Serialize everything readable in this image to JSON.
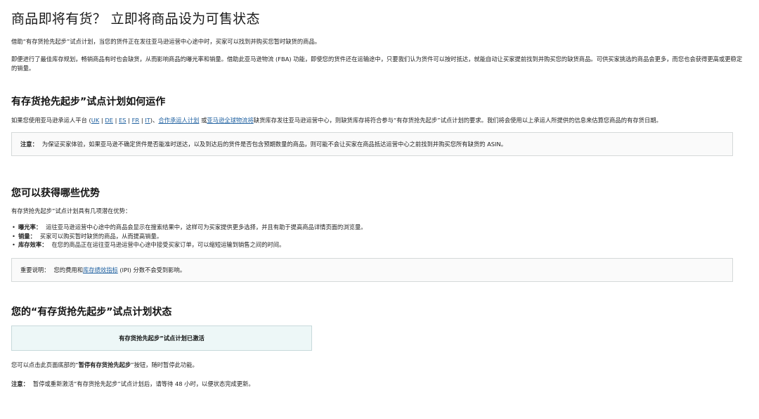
{
  "title": "商品即将有货？ 立即将商品设为可售状态",
  "intro1": "借助“有存货抢先起步”试点计划，当您的货件正在发往亚马逊运营中心途中时，买家可以找到并购买您暂时缺货的商品。",
  "intro2": "即便进行了最佳库存规划，畅销商品有时也会缺货，从而影响商品的曝光率和销量。借助此亚马逊物流 (FBA) 功能，即使您的货件还在运输途中，只要我们认为货件可以按时抵达，就能自动让买家提前找到并购买您的缺货商品。可供买家挑选的商品会更多，而您也会获得更高或更稳定的销量。",
  "how": {
    "heading": "有存货抢先起步”试点计划如何运作",
    "text_before": "如果您使用亚马逊承运人平台 (",
    "sep": " | ",
    "links": [
      "UK",
      "DE",
      "ES",
      "FR",
      "IT"
    ],
    "text_mid1": ")、",
    "partner_link": "合作承运人计划",
    "text_mid2": " 或",
    "global_link": "亚马逊全球物流将",
    "text_after": "缺货库存发往亚马逊运营中心，则缺货库存将符合参与“有存货抢先起步”试点计划的要求。我们将会使用以上承运人所提供的信息来估算您商品的有存货日期。"
  },
  "note1": {
    "label": "注意：",
    "text": "为保证买家体验，如果亚马逊不确定货件是否能准时送达，以及到达后的货件是否包含预期数量的商品，则可能不会让买家在商品抵达运营中心之前找到并购买您所有缺货的 ASIN。"
  },
  "benefits": {
    "heading": "您可以获得哪些优势",
    "intro": "有存货抢先起步”试点计划具有几项潜在优势：",
    "items": [
      {
        "label": "曝光率：",
        "text": "运往亚马逊运营中心途中的商品会显示在搜索结果中，这样可为买家提供更多选择，并且有助于提高商品详情页面的浏览量。"
      },
      {
        "label": "销量：",
        "text": "买家可以购买暂时缺货的商品，从而提高销量。"
      },
      {
        "label": "库存效率：",
        "text": "在您的商品正在运往亚马逊运营中心途中接受买家订单，可以缩短运输到销售之间的时间。"
      }
    ]
  },
  "note2": {
    "label": "重要说明：",
    "text_before": "您的费用和",
    "link": "库存绩效指标",
    "text_after": " (IPI) 分数不会受到影响。"
  },
  "status": {
    "heading": "您的“有存货抢先起步”试点计划状态",
    "box_text": "有存货抢先起步”试点计划已激活",
    "pause_before": "您可以点击此页面底部的“",
    "pause_bold": "暂停有存货抢先起步",
    "pause_after": "”按钮，随时暂停此功能。",
    "final_label": "注意：",
    "final_text": "暂停或重新激活“有存货抢先起步”试点计划后，请等待 48 小时，以便状态完成更新。"
  }
}
